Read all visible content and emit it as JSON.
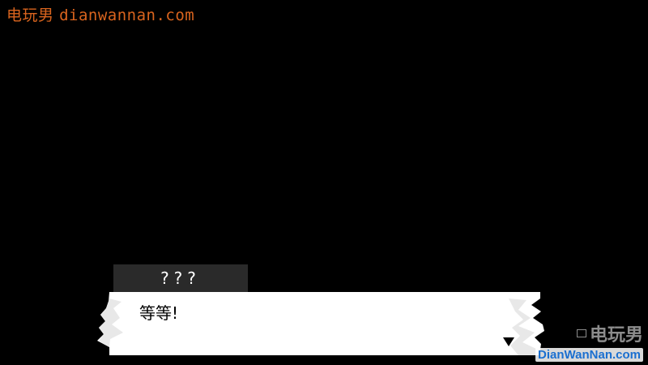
{
  "watermark_top": {
    "cn": "电玩男",
    "url": "dianwannan.com"
  },
  "dialogue": {
    "speaker": "???",
    "text": "等等!"
  },
  "watermark_bottom": {
    "cn": "电玩男",
    "url": "DianWanNan.com"
  },
  "colors": {
    "background": "#000000",
    "box": "#ffffff",
    "speaker_tab": "#2a2a2a",
    "watermark": "#d9641e"
  },
  "icons": {
    "advance": "triangle-down-icon"
  }
}
